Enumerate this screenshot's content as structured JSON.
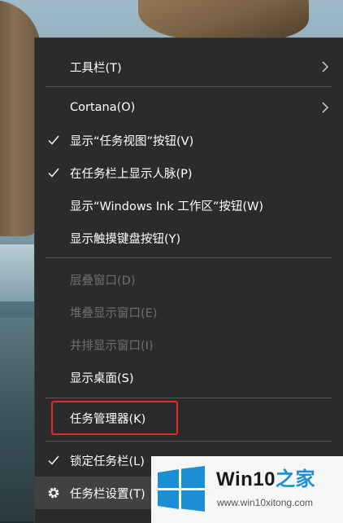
{
  "menu": {
    "items": [
      {
        "label": "工具栏(T)",
        "submenu": true,
        "checked": false,
        "disabled": false
      },
      {
        "label": "Cortana(O)",
        "submenu": true,
        "checked": false,
        "disabled": false
      },
      {
        "label": "显示“任务视图”按钮(V)",
        "submenu": false,
        "checked": true,
        "disabled": false
      },
      {
        "label": "在任务栏上显示人脉(P)",
        "submenu": false,
        "checked": true,
        "disabled": false
      },
      {
        "label": "显示“Windows Ink 工作区”按钮(W)",
        "submenu": false,
        "checked": false,
        "disabled": false
      },
      {
        "label": "显示触摸键盘按钮(Y)",
        "submenu": false,
        "checked": false,
        "disabled": false
      },
      {
        "label": "层叠窗口(D)",
        "submenu": false,
        "checked": false,
        "disabled": true
      },
      {
        "label": "堆叠显示窗口(E)",
        "submenu": false,
        "checked": false,
        "disabled": true
      },
      {
        "label": "并排显示窗口(I)",
        "submenu": false,
        "checked": false,
        "disabled": true
      },
      {
        "label": "显示桌面(S)",
        "submenu": false,
        "checked": false,
        "disabled": false
      },
      {
        "label": "任务管理器(K)",
        "submenu": false,
        "checked": false,
        "disabled": false,
        "highlighted": true
      },
      {
        "label": "锁定任务栏(L)",
        "submenu": false,
        "checked": true,
        "disabled": false
      },
      {
        "label": "任务栏设置(T)",
        "submenu": false,
        "checked": false,
        "disabled": false,
        "icon": "gear-icon"
      }
    ]
  },
  "watermark": {
    "title_prefix": "Win10",
    "title_suffix": "之家",
    "url": "www.win10xitong.com",
    "logo": "windows-logo-icon",
    "accent_color": "#1a8fd6"
  },
  "colors": {
    "menu_bg": "#2b2b2b",
    "highlight_border": "#e8252b",
    "disabled_text": "#6f6f6f"
  }
}
